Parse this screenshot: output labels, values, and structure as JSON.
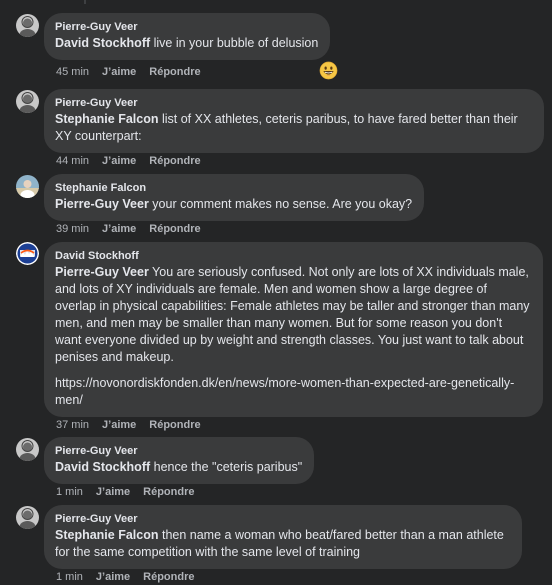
{
  "comments": [
    {
      "author": "Pierre-Guy Veer",
      "mention": "David Stockhoff",
      "text": " live in your bubble of delusion",
      "time": "45 min",
      "like": "J’aime",
      "reply": "Répondre"
    },
    {
      "author": "Pierre-Guy Veer",
      "mention": "Stephanie Falcon",
      "text": " list of XX athletes, ceteris paribus, to have fared better than their XY counterpart:",
      "time": "44 min",
      "like": "J’aime",
      "reply": "Répondre"
    },
    {
      "author": "Stephanie Falcon",
      "mention": "Pierre-Guy Veer",
      "text": " your comment makes no sense. Are you okay?",
      "time": "39 min",
      "like": "J’aime",
      "reply": "Répondre"
    },
    {
      "author": "David Stockhoff",
      "mention": "Pierre-Guy Veer",
      "text": " You are seriously confused. Not only are lots of XX individuals male, and lots of XY individuals are female. Men and women show a large degree of overlap in physical capabilities: Female athletes may be taller and stronger than many men, and men may be smaller than many women. But for some reason you don't want everyone divided up by weight and strength classes. You just want to talk about penises and makeup.",
      "link": "https://novonordiskfonden.dk/en/news/more-women-than-expected-are-genetically-men/",
      "time": "37 min",
      "like": "J’aime",
      "reply": "Répondre"
    },
    {
      "author": "Pierre-Guy Veer",
      "mention": "David Stockhoff",
      "text": " hence the \"ceteris paribus\"",
      "time": "1 min",
      "like": "J’aime",
      "reply": "Répondre"
    },
    {
      "author": "Pierre-Guy Veer",
      "mention": "Stephanie Falcon",
      "text": " then name a woman who beat/fared better than a man athlete for the same competition with the same level of training",
      "time": "1 min",
      "like": "J’aime",
      "reply": "Répondre"
    }
  ],
  "reaction_icon": "grinning-face-emoji",
  "colors": {
    "background": "#242526",
    "bubble": "#3a3b3c",
    "text": "#e4e6eb",
    "meta": "#b0b3b8"
  }
}
